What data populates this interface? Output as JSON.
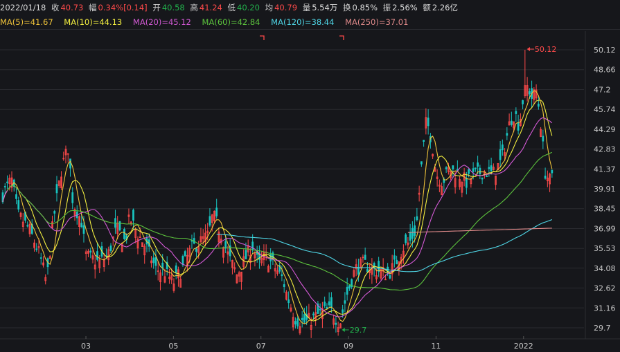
{
  "info": {
    "date": "2022/01/18",
    "close_label": "收",
    "close": "40.73",
    "change_label": "幅",
    "change": "0.34%[0.14]",
    "open_label": "开",
    "open": "40.58",
    "high_label": "高",
    "high": "41.24",
    "low_label": "低",
    "low": "40.20",
    "avg_label": "均",
    "avg": "40.79",
    "volume_label": "量",
    "volume": "5.54万",
    "turnover_label": "换",
    "turnover": "0.85%",
    "amplitude_label": "振",
    "amplitude": "2.56%",
    "amount_label": "额",
    "amount": "2.26亿"
  },
  "ma_legend": [
    {
      "text": "MA(5)=41.67",
      "color": "#f0c43a"
    },
    {
      "text": "MA(10)=44.13",
      "color": "#f4f040"
    },
    {
      "text": "MA(20)=45.12",
      "color": "#d45ad6"
    },
    {
      "text": "MA(60)=42.84",
      "color": "#5cc33d"
    },
    {
      "text": "MA(120)=38.44",
      "color": "#4fd6e6"
    },
    {
      "text": "MA(250)=37.01",
      "color": "#e08a8a"
    }
  ],
  "colors": {
    "up": "#ff4a4a",
    "down": "#22b14c",
    "grid": "#2a2b30",
    "axis_text": "#c8c8c8"
  },
  "chart_data": {
    "type": "candlestick",
    "y_ticks": [
      "50.12",
      "48.66",
      "47.2",
      "45.74",
      "44.29",
      "42.83",
      "41.37",
      "39.91",
      "38.45",
      "36.99",
      "35.53",
      "34.08",
      "32.62",
      "31.16",
      "29.7"
    ],
    "ylim": [
      29.7,
      50.12
    ],
    "x_ticks": [
      {
        "label": "03",
        "month": 2.0
      },
      {
        "label": "05",
        "month": 4.0
      },
      {
        "label": "07",
        "month": 6.0
      },
      {
        "label": "09",
        "month": 8.0
      },
      {
        "label": "11",
        "month": 10.0
      },
      {
        "label": "2022",
        "month": 12.0
      }
    ],
    "xlim_months": [
      0.1,
      12.7
    ],
    "annotations": [
      {
        "text": "50.12",
        "month": 12.05,
        "value": 50.12,
        "kind": "high"
      },
      {
        "text": "29.7",
        "month": 7.82,
        "value": 29.7,
        "kind": "low"
      }
    ],
    "anchors": [
      [
        0.1,
        39.5
      ],
      [
        0.3,
        40.6
      ],
      [
        0.45,
        38.0
      ],
      [
        0.7,
        37.0
      ],
      [
        0.95,
        35.0
      ],
      [
        1.1,
        33.0
      ],
      [
        1.25,
        37.5
      ],
      [
        1.45,
        41.5
      ],
      [
        1.6,
        43.0
      ],
      [
        1.7,
        39.0
      ],
      [
        1.9,
        37.5
      ],
      [
        2.0,
        35.0
      ],
      [
        2.3,
        34.5
      ],
      [
        2.5,
        35.0
      ],
      [
        2.7,
        37.0
      ],
      [
        2.9,
        36.0
      ],
      [
        3.0,
        37.8
      ],
      [
        3.2,
        36.5
      ],
      [
        3.4,
        35.5
      ],
      [
        3.6,
        34.0
      ],
      [
        3.8,
        33.8
      ],
      [
        4.0,
        33.0
      ],
      [
        4.2,
        34.0
      ],
      [
        4.4,
        35.5
      ],
      [
        4.6,
        36.0
      ],
      [
        4.8,
        36.5
      ],
      [
        4.9,
        38.0
      ],
      [
        5.05,
        37.0
      ],
      [
        5.25,
        35.0
      ],
      [
        5.45,
        33.6
      ],
      [
        5.6,
        34.5
      ],
      [
        5.8,
        35.8
      ],
      [
        5.95,
        34.3
      ],
      [
        6.1,
        35.0
      ],
      [
        6.3,
        34.2
      ],
      [
        6.5,
        33.3
      ],
      [
        6.6,
        32.0
      ],
      [
        6.8,
        30.3
      ],
      [
        7.0,
        30.1
      ],
      [
        7.2,
        30.4
      ],
      [
        7.4,
        30.9
      ],
      [
        7.6,
        31.0
      ],
      [
        7.8,
        30.0
      ],
      [
        7.95,
        32.0
      ],
      [
        8.15,
        34.0
      ],
      [
        8.35,
        34.4
      ],
      [
        8.55,
        34.0
      ],
      [
        8.75,
        33.8
      ],
      [
        8.9,
        33.6
      ],
      [
        9.05,
        34.3
      ],
      [
        9.25,
        35.6
      ],
      [
        9.4,
        36.0
      ],
      [
        9.55,
        37.0
      ],
      [
        9.65,
        41.0
      ],
      [
        9.78,
        45.0
      ],
      [
        9.9,
        43.5
      ],
      [
        10.0,
        41.0
      ],
      [
        10.15,
        40.4
      ],
      [
        10.3,
        41.4
      ],
      [
        10.5,
        41.0
      ],
      [
        10.7,
        40.4
      ],
      [
        10.9,
        41.0
      ],
      [
        11.1,
        41.2
      ],
      [
        11.3,
        41.0
      ],
      [
        11.5,
        42.0
      ],
      [
        11.6,
        43.5
      ],
      [
        11.7,
        45.0
      ],
      [
        11.8,
        45.5
      ],
      [
        11.9,
        44.5
      ],
      [
        12.0,
        46.8
      ],
      [
        12.1,
        47.5
      ],
      [
        12.2,
        46.5
      ],
      [
        12.3,
        47.2
      ],
      [
        12.4,
        44.5
      ],
      [
        12.5,
        41.0
      ],
      [
        12.6,
        40.5
      ],
      [
        12.65,
        40.7
      ]
    ]
  }
}
